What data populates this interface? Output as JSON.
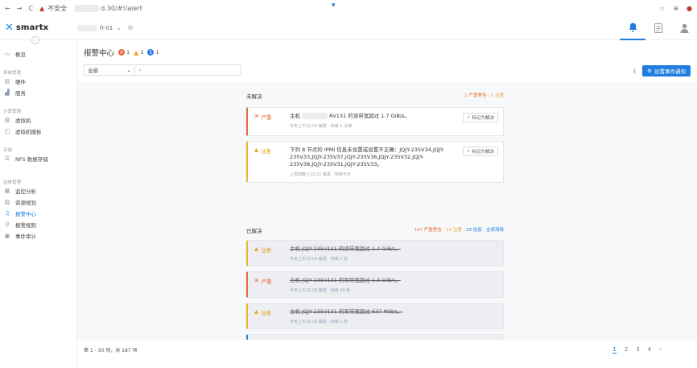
{
  "browser": {
    "back": "←",
    "forward": "→",
    "reload": "C",
    "warning": "▲",
    "insecure_label": "不安全",
    "url": "d.30/#!/alert"
  },
  "header": {
    "brand": "smartx",
    "cluster_name": "fr-01",
    "cluster_chevron": "⌄",
    "icons": [
      "bell-icon",
      "document-icon",
      "user-icon"
    ]
  },
  "sidebar": {
    "groups": [
      {
        "label": "",
        "items": [
          {
            "icon": "monitor-icon",
            "label": "概览"
          }
        ]
      },
      {
        "label": "系统管理",
        "items": [
          {
            "icon": "server-icon",
            "label": "硬件"
          },
          {
            "icon": "chart-icon",
            "label": "服务"
          }
        ]
      },
      {
        "label": "计算管理",
        "items": [
          {
            "icon": "vm-icon",
            "label": "虚拟机"
          },
          {
            "icon": "template-icon",
            "label": "虚拟机模板"
          }
        ]
      },
      {
        "label": "存储",
        "items": [
          {
            "icon": "storage-icon",
            "label": "NFS 数据存储"
          }
        ]
      },
      {
        "label": "运维管理",
        "items": [
          {
            "icon": "analysis-icon",
            "label": "监控分析"
          },
          {
            "icon": "resource-icon",
            "label": "资源规划"
          },
          {
            "icon": "alarm-icon",
            "label": "报警中心"
          },
          {
            "icon": "rule-icon",
            "label": "报警规则"
          },
          {
            "icon": "audit-icon",
            "label": "事件审计"
          }
        ]
      }
    ]
  },
  "page": {
    "title": "报警中心",
    "badges": {
      "critical": "1",
      "warning": "1",
      "info": "1"
    },
    "filter_value": "全部",
    "search_icon": "⌕",
    "notify_button": "设置事件通知"
  },
  "unresolved": {
    "label": "未解决",
    "summary_critical": "1 严重警告",
    "summary_sep": " · ",
    "summary_warning": "1 注意",
    "cards": [
      {
        "severity": "严重",
        "text_prefix": "主机",
        "text_suffix": "6V131 的读带宽超过 1.7 GiB/s。",
        "meta": "今天上午11:03 触发 · 持续 1 分钟",
        "resolve_label": "标记为解决"
      },
      {
        "severity": "注意",
        "text": "下列 8 节点的 IPMI 信息未设置或设置不正确：JQJY-235V34,JQJY-235V33,JQJY-235V37,JQJY-235V36,JQJY-235V32,JQJY-235V38,JQJY-235V31,JQJY-235V33。",
        "meta": "上周四晚上10:21 触发 · 持续大天",
        "resolve_label": "标记为解决"
      }
    ]
  },
  "resolved": {
    "label": "已解决",
    "summary_critical": "147 严重警告",
    "summary_sep": " · ",
    "summary_warning": "13 注意",
    "summary_info": "28 信息",
    "summary_clear": "全部清除",
    "cards": [
      {
        "severity": "注意",
        "text": "主机 JQJY-235V131 的读带宽超过 1.4 GiB/s。",
        "meta": "今天上午11:03 触发 · 持续 1 秒"
      },
      {
        "severity": "严重",
        "text": "主机 JQJY-235V131 的写带宽超过 1.3 GiB/s。",
        "meta": "今天上午11:03 触发 · 持续 30 秒"
      },
      {
        "severity": "注意",
        "text": "主机 JQJY-235V131 的写带宽超过 637 MiB/s。",
        "meta": "今天上午11:03 触发 · 持续 1 秒"
      }
    ]
  },
  "footer": {
    "range": "第 1 - 50 项，共 187 项",
    "pages": [
      "1",
      "2",
      "3",
      "4"
    ],
    "next": "›"
  }
}
